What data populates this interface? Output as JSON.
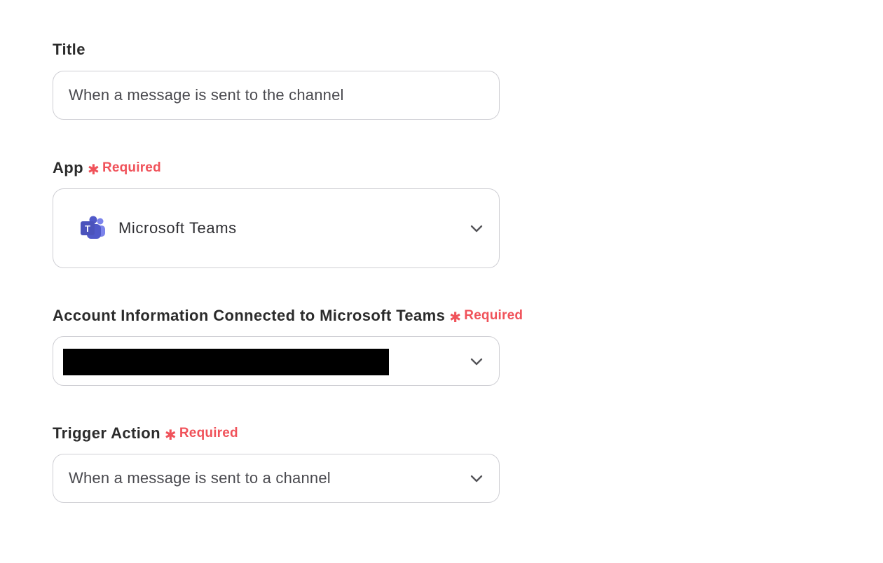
{
  "title_field": {
    "label": "Title",
    "value": "When a message is sent to the channel"
  },
  "app_field": {
    "label": "App",
    "required": "Required",
    "value": "Microsoft Teams",
    "icon": "microsoft-teams-icon"
  },
  "account_field": {
    "label": "Account Information Connected to Microsoft Teams",
    "required": "Required",
    "value_redacted": true
  },
  "trigger_field": {
    "label": "Trigger Action",
    "required": "Required",
    "value": "When a message is sent to a channel"
  },
  "colors": {
    "required": "#f0525a",
    "border": "#cfcfd4",
    "teams_brand": "#5059c9"
  }
}
